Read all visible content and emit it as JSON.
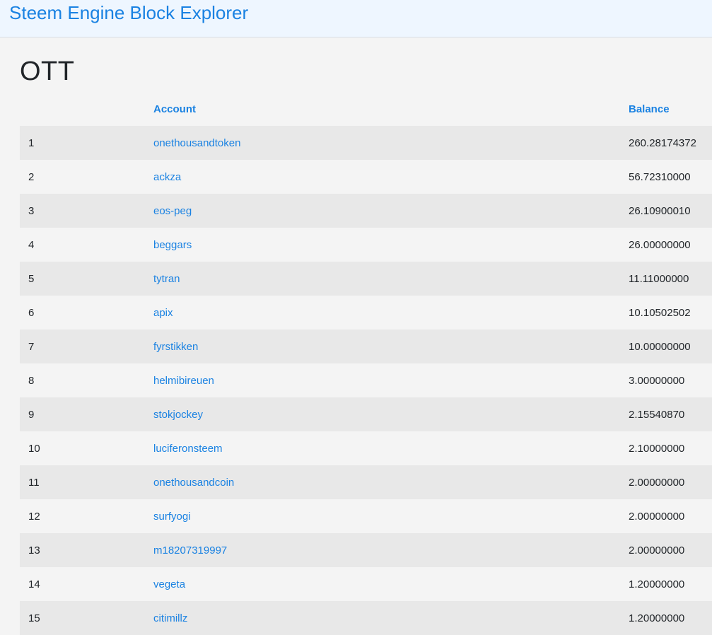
{
  "navbar": {
    "brand": "Steem Engine Block Explorer"
  },
  "page": {
    "title": "OTT"
  },
  "table": {
    "headers": {
      "rank": "",
      "account": "Account",
      "balance": "Balance"
    },
    "rows": [
      {
        "rank": "1",
        "account": "onethousandtoken",
        "balance": "260.28174372"
      },
      {
        "rank": "2",
        "account": "ackza",
        "balance": "56.72310000"
      },
      {
        "rank": "3",
        "account": "eos-peg",
        "balance": "26.10900010"
      },
      {
        "rank": "4",
        "account": "beggars",
        "balance": "26.00000000"
      },
      {
        "rank": "5",
        "account": "tytran",
        "balance": "11.11000000"
      },
      {
        "rank": "6",
        "account": "apix",
        "balance": "10.10502502"
      },
      {
        "rank": "7",
        "account": "fyrstikken",
        "balance": "10.00000000"
      },
      {
        "rank": "8",
        "account": "helmibireuen",
        "balance": "3.00000000"
      },
      {
        "rank": "9",
        "account": "stokjockey",
        "balance": "2.15540870"
      },
      {
        "rank": "10",
        "account": "luciferonsteem",
        "balance": "2.10000000"
      },
      {
        "rank": "11",
        "account": "onethousandcoin",
        "balance": "2.00000000"
      },
      {
        "rank": "12",
        "account": "surfyogi",
        "balance": "2.00000000"
      },
      {
        "rank": "13",
        "account": "m18207319997",
        "balance": "2.00000000"
      },
      {
        "rank": "14",
        "account": "vegeta",
        "balance": "1.20000000"
      },
      {
        "rank": "15",
        "account": "citimillz",
        "balance": "1.20000000"
      }
    ]
  }
}
